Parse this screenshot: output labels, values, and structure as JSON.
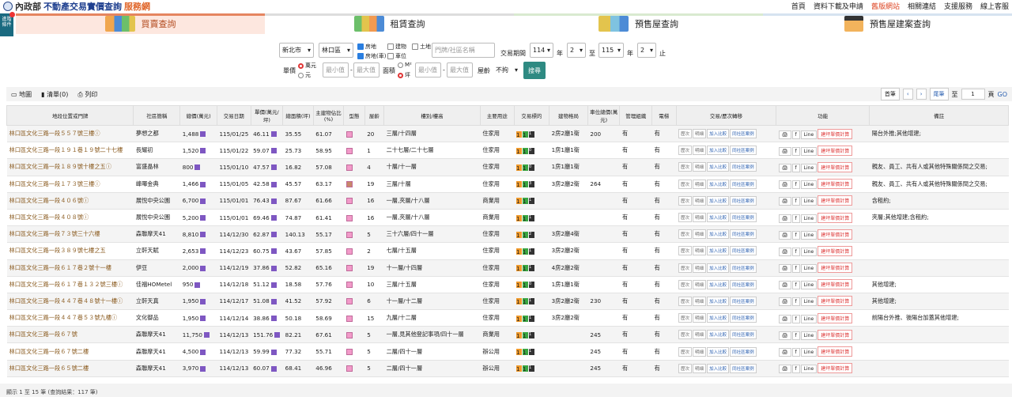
{
  "header": {
    "logo_gov": "內政部",
    "logo_main": "不動產交易實價查詢",
    "logo_sub": "服務網",
    "nav": [
      "首頁",
      "資料下載及申請",
      "舊版網站",
      "相關連結",
      "支援服務",
      "線上客服"
    ]
  },
  "side_button": {
    "label_line1": "進階",
    "label_line2": "條件"
  },
  "tabs": [
    "買賣查詢",
    "租賃查詢",
    "預售屋查詢",
    "預售屋建案查詢"
  ],
  "filters": {
    "city": "新北市",
    "district": "林口區",
    "chk_land": "房地",
    "chk_land_car": "房地(車)",
    "chk_building": "建物",
    "chk_parking": "車位",
    "chk_landonly": "土地",
    "keyword_placeholder": "門牌/社區名稱",
    "period_label": "交易期間",
    "year_from": "114",
    "month_from": "2",
    "year_to": "115",
    "month_to": "2",
    "unit_year": "年",
    "to_word": "至",
    "unit_end": "止",
    "price_label": "單價",
    "price_unit_a": "萬元",
    "price_unit_b": "元",
    "min_placeholder": "最小值",
    "max_placeholder": "最大值",
    "area_label": "面積",
    "area_unit_a": "M²",
    "area_unit_b": "坪",
    "age_label": "屋齡",
    "age_value": "不拘",
    "search_button": "搜尋"
  },
  "toolbar": {
    "map": "地圖",
    "list": "清單(0)",
    "print": "列印",
    "first": "首筆",
    "prev": "‹",
    "next": "›",
    "last": "尾筆",
    "to": "至",
    "page": "1",
    "unit": "頁",
    "go": "GO"
  },
  "columns": [
    "地段位置或門牌",
    "社區簡稱",
    "總價(萬元)",
    "交易日期",
    "單價(萬元/坪)",
    "總面積(坪)",
    "主建物佔比(%)",
    "型態",
    "屋齡",
    "樓別/樓高",
    "主要用途",
    "交易標的",
    "建物格局",
    "車位總價(萬元)",
    "管理組織",
    "電梯",
    "交易/歷次轉移",
    "功能",
    "備註"
  ],
  "row_buttons": [
    "歷次",
    "明細",
    "加入比較",
    "同社區案例"
  ],
  "func_buttons": [
    "🖨",
    "f",
    "Line",
    "建坪單價計算"
  ],
  "rows": [
    {
      "addr": "林口區文化三路一段５５７號三樓",
      "info": true,
      "community": "夢想之都",
      "price": "1,488",
      "date": "115/01/25",
      "unit": "46.11",
      "area": "35.55",
      "ratio": "61.07",
      "type": "a",
      "age": "20",
      "floor": "三層/十四層",
      "use": "住家用",
      "tk": [
        "1",
        "1",
        "1"
      ],
      "layout": "2房2廳1衛",
      "parking": "200",
      "mgmt": "有",
      "lift": "有",
      "note": "陽台外推;其他增建;"
    },
    {
      "addr": "林口區文化三路一段１９１巷１９號二十七樓",
      "info": false,
      "community": "長耀初",
      "price": "1,520",
      "date": "115/01/22",
      "unit": "59.07",
      "area": "25.73",
      "ratio": "58.95",
      "type": "a",
      "age": "1",
      "floor": "二十七層/二十七層",
      "use": "住家用",
      "tk": [
        "1",
        "1",
        "0"
      ],
      "layout": "1房1廳1衛",
      "parking": "",
      "mgmt": "有",
      "lift": "有",
      "note": ""
    },
    {
      "addr": "林口區文化三路一段１８９號十樓之五",
      "info": true,
      "community": "富盛晶林",
      "price": "800",
      "date": "115/01/10",
      "unit": "47.57",
      "area": "16.82",
      "ratio": "57.08",
      "type": "a",
      "age": "4",
      "floor": "十層/十一層",
      "use": "住家用",
      "tk": [
        "1",
        "1",
        "0"
      ],
      "layout": "1房1廳1衛",
      "parking": "",
      "mgmt": "有",
      "lift": "有",
      "note": "親友、員工、共有人或其他特殊關係間之交易;"
    },
    {
      "addr": "林口區文化三路一段１７３號三樓",
      "info": true,
      "community": "峰暉金典",
      "price": "1,466",
      "date": "115/01/05",
      "unit": "42.58",
      "area": "45.57",
      "ratio": "63.17",
      "type": "b",
      "age": "19",
      "floor": "三層/十層",
      "use": "住家用",
      "tk": [
        "1",
        "1",
        "3"
      ],
      "layout": "3房2廳2衛",
      "parking": "264",
      "mgmt": "有",
      "lift": "有",
      "note": "親友、員工、共有人或其他特殊關係間之交易;"
    },
    {
      "addr": "林口區文化三路一段４０６號",
      "info": true,
      "community": "展悅中央公園",
      "price": "6,700",
      "date": "115/01/01",
      "unit": "76.43",
      "area": "87.67",
      "ratio": "61.66",
      "type": "a",
      "age": "16",
      "floor": "一層,夾層/十八層",
      "use": "商業用",
      "tk": [
        "1",
        "1",
        "1"
      ],
      "layout": "",
      "parking": "",
      "mgmt": "有",
      "lift": "有",
      "note": "含租約;"
    },
    {
      "addr": "林口區文化三路一段４０８號",
      "info": true,
      "community": "展悅中央公園",
      "price": "5,200",
      "date": "115/01/01",
      "unit": "69.46",
      "area": "74.87",
      "ratio": "61.41",
      "type": "a",
      "age": "16",
      "floor": "一層,夾層/十八層",
      "use": "商業用",
      "tk": [
        "1",
        "1",
        "1"
      ],
      "layout": "",
      "parking": "",
      "mgmt": "有",
      "lift": "有",
      "note": "夾層;其他增建;含租約;"
    },
    {
      "addr": "林口區文化三路一段７３號三十六樓",
      "info": false,
      "community": "森聯摩天41",
      "price": "8,810",
      "date": "114/12/30",
      "unit": "62.87",
      "area": "140.13",
      "ratio": "55.17",
      "type": "a",
      "age": "5",
      "floor": "三十六層/四十一層",
      "use": "住家用",
      "tk": [
        "1",
        "1",
        "2"
      ],
      "layout": "3房2廳4衛",
      "parking": "",
      "mgmt": "有",
      "lift": "有",
      "note": ""
    },
    {
      "addr": "林口區文化三路一段３８９號七樓之五",
      "info": false,
      "community": "立軒天賦",
      "price": "2,653",
      "date": "114/12/23",
      "unit": "60.75",
      "area": "43.67",
      "ratio": "57.85",
      "type": "a",
      "age": "2",
      "floor": "七層/十五層",
      "use": "住家用",
      "tk": [
        "1",
        "1",
        "1"
      ],
      "layout": "3房2廳2衛",
      "parking": "",
      "mgmt": "有",
      "lift": "有",
      "note": ""
    },
    {
      "addr": "林口區文化三路一段６１７巷２號十一樓",
      "info": false,
      "community": "伊豆",
      "price": "2,000",
      "date": "114/12/19",
      "unit": "37.86",
      "area": "52.82",
      "ratio": "65.16",
      "type": "a",
      "age": "19",
      "floor": "十一層/十四層",
      "use": "住家用",
      "tk": [
        "1",
        "1",
        "1"
      ],
      "layout": "4房2廳2衛",
      "parking": "",
      "mgmt": "有",
      "lift": "有",
      "note": ""
    },
    {
      "addr": "林口區文化三路一段６１７巷１３２號三樓",
      "info": true,
      "community": "佳福HOMetel",
      "price": "950",
      "date": "114/12/18",
      "unit": "51.12",
      "area": "18.58",
      "ratio": "57.76",
      "type": "a",
      "age": "10",
      "floor": "三層/十五層",
      "use": "住家用",
      "tk": [
        "1",
        "1",
        "0"
      ],
      "layout": "1房1廳1衛",
      "parking": "",
      "mgmt": "有",
      "lift": "有",
      "note": "其他增建;"
    },
    {
      "addr": "林口區文化三路一段４４７巷４８號十一樓",
      "info": true,
      "community": "立軒天真",
      "price": "1,950",
      "date": "114/12/17",
      "unit": "51.08",
      "area": "41.52",
      "ratio": "57.92",
      "type": "a",
      "age": "6",
      "floor": "十一層/十二層",
      "use": "住家用",
      "tk": [
        "1",
        "1",
        "1"
      ],
      "layout": "3房2廳2衛",
      "parking": "230",
      "mgmt": "有",
      "lift": "有",
      "note": "其他增建;"
    },
    {
      "addr": "林口區文化三路一段４４７巷５３號九樓",
      "info": true,
      "community": "文化御品",
      "price": "1,950",
      "date": "114/12/14",
      "unit": "38.86",
      "area": "50.18",
      "ratio": "58.69",
      "type": "a",
      "age": "15",
      "floor": "九層/十二層",
      "use": "住家用",
      "tk": [
        "1",
        "1",
        "1"
      ],
      "layout": "3房2廳2衛",
      "parking": "",
      "mgmt": "有",
      "lift": "有",
      "note": "前陽台外推、後陽台加蓋其他增建;"
    },
    {
      "addr": "林口區文化三路一段６７號",
      "info": false,
      "community": "森聯摩天41",
      "price": "11,750",
      "date": "114/12/13",
      "unit": "151.76",
      "area": "82.21",
      "ratio": "67.61",
      "type": "a",
      "age": "5",
      "floor": "一層,見其他登記事項/四十一層",
      "use": "商業用",
      "tk": [
        "1",
        "1",
        "1"
      ],
      "layout": "",
      "parking": "245",
      "mgmt": "有",
      "lift": "有",
      "note": ""
    },
    {
      "addr": "林口區文化三路一段６７號二樓",
      "info": false,
      "community": "森聯摩天41",
      "price": "4,500",
      "date": "114/12/13",
      "unit": "59.99",
      "area": "77.32",
      "ratio": "55.71",
      "type": "a",
      "age": "5",
      "floor": "二層/四十一層",
      "use": "辦公用",
      "tk": [
        "1",
        "1",
        "1"
      ],
      "layout": "",
      "parking": "245",
      "mgmt": "有",
      "lift": "有",
      "note": ""
    },
    {
      "addr": "林口區文化三路一段６５號二樓",
      "info": false,
      "community": "森聯摩天41",
      "price": "3,970",
      "date": "114/12/13",
      "unit": "60.07",
      "area": "68.41",
      "ratio": "46.96",
      "type": "a",
      "age": "5",
      "floor": "二層/四十一層",
      "use": "辦公用",
      "tk": [
        "1",
        "1",
        "1"
      ],
      "layout": "",
      "parking": "245",
      "mgmt": "有",
      "lift": "有",
      "note": ""
    }
  ],
  "footer": {
    "summary": "顯示 1 至 15 筆 (查詢結果：117 筆)"
  }
}
